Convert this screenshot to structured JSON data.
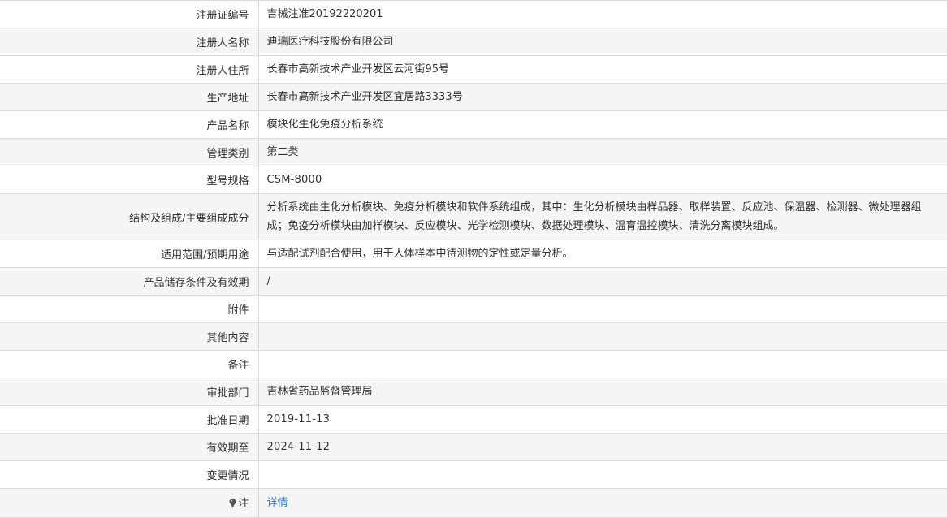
{
  "rows": [
    {
      "label": "注册证编号",
      "value": "吉械注准20192220201"
    },
    {
      "label": "注册人名称",
      "value": "迪瑞医疗科技股份有限公司"
    },
    {
      "label": "注册人住所",
      "value": "长春市高新技术产业开发区云河街95号"
    },
    {
      "label": "生产地址",
      "value": "长春市高新技术产业开发区宜居路3333号"
    },
    {
      "label": "产品名称",
      "value": "模块化生化免疫分析系统"
    },
    {
      "label": "管理类别",
      "value": "第二类"
    },
    {
      "label": "型号规格",
      "value": "CSM-8000"
    },
    {
      "label": "结构及组成/主要组成成分",
      "value": "分析系统由生化分析模块、免疫分析模块和软件系统组成，其中：生化分析模块由样品器、取样装置、反应池、保温器、检测器、微处理器组成；免疫分析模块由加样模块、反应模块、光学检测模块、数据处理模块、温育温控模块、清洗分离模块组成。"
    },
    {
      "label": "适用范围/预期用途",
      "value": "与适配试剂配合使用，用于人体样本中待测物的定性或定量分析。"
    },
    {
      "label": "产品储存条件及有效期",
      "value": "/"
    },
    {
      "label": "附件",
      "value": ""
    },
    {
      "label": "其他内容",
      "value": ""
    },
    {
      "label": "备注",
      "value": ""
    },
    {
      "label": "审批部门",
      "value": "吉林省药品监督管理局"
    },
    {
      "label": "批准日期",
      "value": "2019-11-13"
    },
    {
      "label": "有效期至",
      "value": "2024-11-12"
    },
    {
      "label": "变更情况",
      "value": ""
    }
  ],
  "note_row": {
    "label": "注",
    "icon": "pin-icon",
    "link_label": "详情",
    "link_color": "#2d7fc8"
  },
  "colors": {
    "shade": "#f5f5f5",
    "border": "#dcdcdc",
    "text": "#333333"
  }
}
